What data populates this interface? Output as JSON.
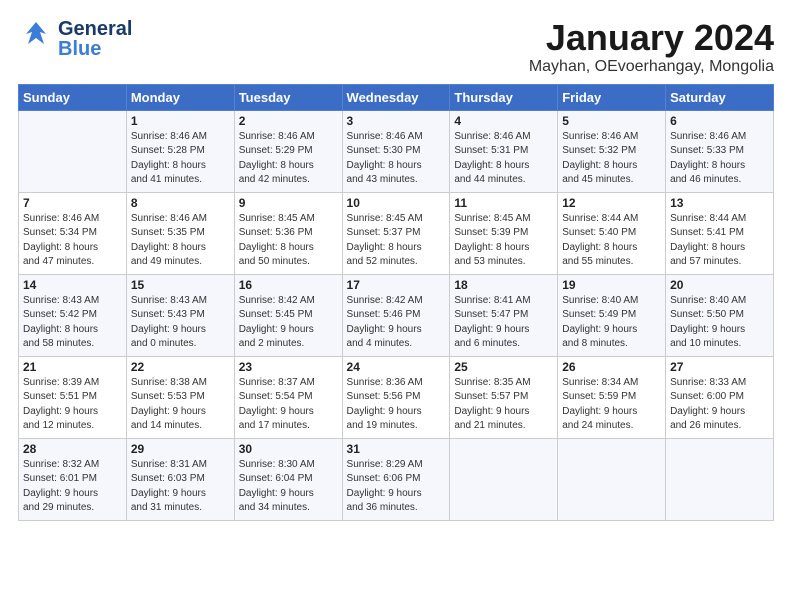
{
  "header": {
    "logo_general": "General",
    "logo_blue": "Blue",
    "month_title": "January 2024",
    "location": "Mayhan, OEvoerhangay, Mongolia"
  },
  "weekdays": [
    "Sunday",
    "Monday",
    "Tuesday",
    "Wednesday",
    "Thursday",
    "Friday",
    "Saturday"
  ],
  "weeks": [
    [
      {
        "day": "",
        "info": ""
      },
      {
        "day": "1",
        "info": "Sunrise: 8:46 AM\nSunset: 5:28 PM\nDaylight: 8 hours\nand 41 minutes."
      },
      {
        "day": "2",
        "info": "Sunrise: 8:46 AM\nSunset: 5:29 PM\nDaylight: 8 hours\nand 42 minutes."
      },
      {
        "day": "3",
        "info": "Sunrise: 8:46 AM\nSunset: 5:30 PM\nDaylight: 8 hours\nand 43 minutes."
      },
      {
        "day": "4",
        "info": "Sunrise: 8:46 AM\nSunset: 5:31 PM\nDaylight: 8 hours\nand 44 minutes."
      },
      {
        "day": "5",
        "info": "Sunrise: 8:46 AM\nSunset: 5:32 PM\nDaylight: 8 hours\nand 45 minutes."
      },
      {
        "day": "6",
        "info": "Sunrise: 8:46 AM\nSunset: 5:33 PM\nDaylight: 8 hours\nand 46 minutes."
      }
    ],
    [
      {
        "day": "7",
        "info": "Sunrise: 8:46 AM\nSunset: 5:34 PM\nDaylight: 8 hours\nand 47 minutes."
      },
      {
        "day": "8",
        "info": "Sunrise: 8:46 AM\nSunset: 5:35 PM\nDaylight: 8 hours\nand 49 minutes."
      },
      {
        "day": "9",
        "info": "Sunrise: 8:45 AM\nSunset: 5:36 PM\nDaylight: 8 hours\nand 50 minutes."
      },
      {
        "day": "10",
        "info": "Sunrise: 8:45 AM\nSunset: 5:37 PM\nDaylight: 8 hours\nand 52 minutes."
      },
      {
        "day": "11",
        "info": "Sunrise: 8:45 AM\nSunset: 5:39 PM\nDaylight: 8 hours\nand 53 minutes."
      },
      {
        "day": "12",
        "info": "Sunrise: 8:44 AM\nSunset: 5:40 PM\nDaylight: 8 hours\nand 55 minutes."
      },
      {
        "day": "13",
        "info": "Sunrise: 8:44 AM\nSunset: 5:41 PM\nDaylight: 8 hours\nand 57 minutes."
      }
    ],
    [
      {
        "day": "14",
        "info": "Sunrise: 8:43 AM\nSunset: 5:42 PM\nDaylight: 8 hours\nand 58 minutes."
      },
      {
        "day": "15",
        "info": "Sunrise: 8:43 AM\nSunset: 5:43 PM\nDaylight: 9 hours\nand 0 minutes."
      },
      {
        "day": "16",
        "info": "Sunrise: 8:42 AM\nSunset: 5:45 PM\nDaylight: 9 hours\nand 2 minutes."
      },
      {
        "day": "17",
        "info": "Sunrise: 8:42 AM\nSunset: 5:46 PM\nDaylight: 9 hours\nand 4 minutes."
      },
      {
        "day": "18",
        "info": "Sunrise: 8:41 AM\nSunset: 5:47 PM\nDaylight: 9 hours\nand 6 minutes."
      },
      {
        "day": "19",
        "info": "Sunrise: 8:40 AM\nSunset: 5:49 PM\nDaylight: 9 hours\nand 8 minutes."
      },
      {
        "day": "20",
        "info": "Sunrise: 8:40 AM\nSunset: 5:50 PM\nDaylight: 9 hours\nand 10 minutes."
      }
    ],
    [
      {
        "day": "21",
        "info": "Sunrise: 8:39 AM\nSunset: 5:51 PM\nDaylight: 9 hours\nand 12 minutes."
      },
      {
        "day": "22",
        "info": "Sunrise: 8:38 AM\nSunset: 5:53 PM\nDaylight: 9 hours\nand 14 minutes."
      },
      {
        "day": "23",
        "info": "Sunrise: 8:37 AM\nSunset: 5:54 PM\nDaylight: 9 hours\nand 17 minutes."
      },
      {
        "day": "24",
        "info": "Sunrise: 8:36 AM\nSunset: 5:56 PM\nDaylight: 9 hours\nand 19 minutes."
      },
      {
        "day": "25",
        "info": "Sunrise: 8:35 AM\nSunset: 5:57 PM\nDaylight: 9 hours\nand 21 minutes."
      },
      {
        "day": "26",
        "info": "Sunrise: 8:34 AM\nSunset: 5:59 PM\nDaylight: 9 hours\nand 24 minutes."
      },
      {
        "day": "27",
        "info": "Sunrise: 8:33 AM\nSunset: 6:00 PM\nDaylight: 9 hours\nand 26 minutes."
      }
    ],
    [
      {
        "day": "28",
        "info": "Sunrise: 8:32 AM\nSunset: 6:01 PM\nDaylight: 9 hours\nand 29 minutes."
      },
      {
        "day": "29",
        "info": "Sunrise: 8:31 AM\nSunset: 6:03 PM\nDaylight: 9 hours\nand 31 minutes."
      },
      {
        "day": "30",
        "info": "Sunrise: 8:30 AM\nSunset: 6:04 PM\nDaylight: 9 hours\nand 34 minutes."
      },
      {
        "day": "31",
        "info": "Sunrise: 8:29 AM\nSunset: 6:06 PM\nDaylight: 9 hours\nand 36 minutes."
      },
      {
        "day": "",
        "info": ""
      },
      {
        "day": "",
        "info": ""
      },
      {
        "day": "",
        "info": ""
      }
    ]
  ]
}
